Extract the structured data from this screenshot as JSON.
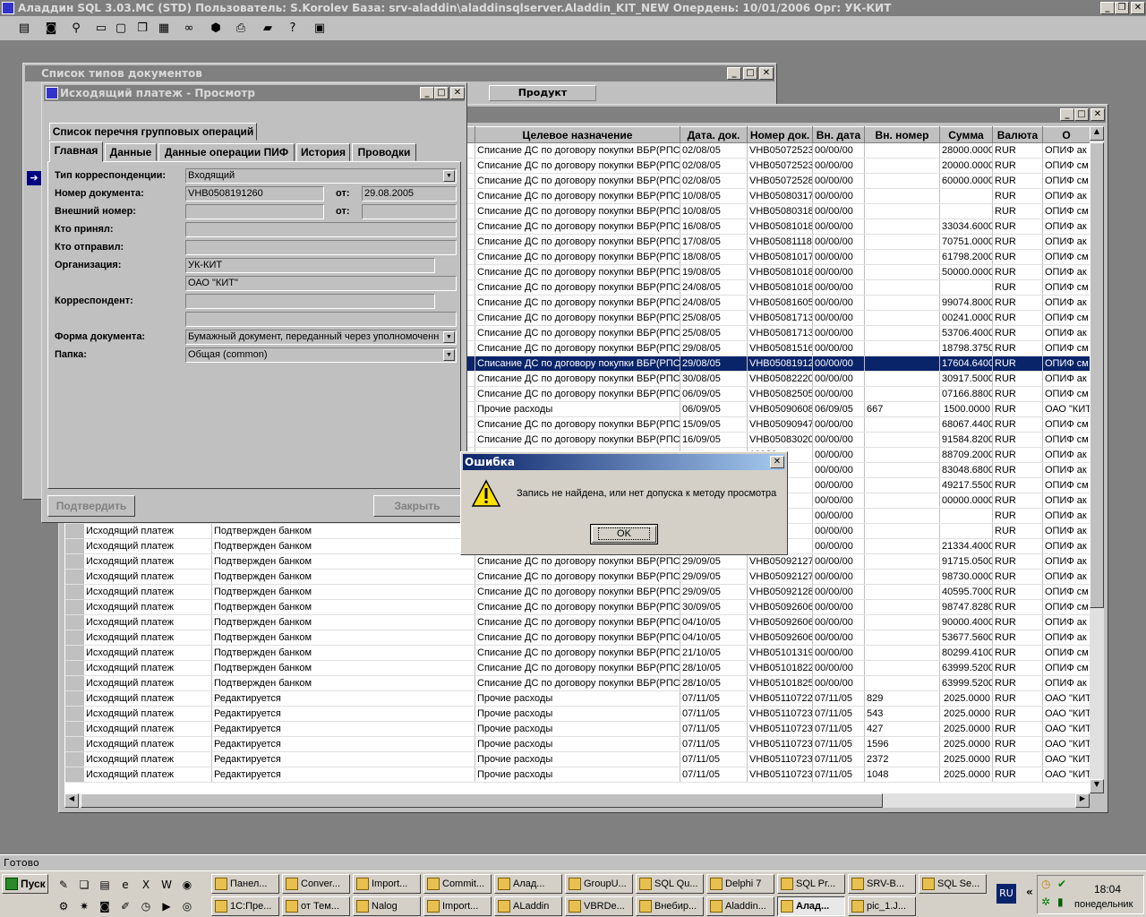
{
  "app": {
    "title": "Аладдин SQL 3.03.МС (STD)  Пользователь: S.Korolev База: srv-aladdin\\aladdinsqlserver.Aladdin_KIT_NEW Опердень: 10/01/2006 Орг: УК-КИТ"
  },
  "toolbar": {
    "icons": [
      "list-icon",
      "cylinder-icon",
      "find-person-icon",
      "window-icon",
      "windows-icon",
      "cascade-icon",
      "tile-icon",
      "binoculars-icon",
      "stop-icon",
      "printer-icon",
      "truck-icon",
      "help-icon",
      "exit-icon"
    ]
  },
  "doctypes_window": {
    "title": "Список типов документов",
    "col_product": "Продукт"
  },
  "list_window": {
    "columns": [
      "",
      "",
      "Целевое назначение",
      "Дата. док.",
      "Номер док.",
      "Вн. дата",
      "Вн. номер",
      "Сумма",
      "Валюта",
      "О"
    ],
    "rows": [
      [
        "",
        "",
        "Списание ДС по договору покупки ВБР(РПС",
        "02/08/05",
        "VHB050725230",
        "00/00/00",
        "",
        "28000.0000",
        "RUR",
        "ОПИФ ак"
      ],
      [
        "",
        "",
        "Списание ДС по договору покупки ВБР(РПС",
        "02/08/05",
        "VHB050725230",
        "00/00/00",
        "",
        "20000.0000",
        "RUR",
        "ОПИФ см"
      ],
      [
        "",
        "",
        "Списание ДС по договору покупки ВБР(РПС",
        "02/08/05",
        "VHB050725280",
        "00/00/00",
        "",
        "60000.0000",
        "RUR",
        "ОПИФ см"
      ],
      [
        "",
        "",
        "Списание ДС по договору покупки ВБР(РПС",
        "10/08/05",
        "VHB050803170",
        "00/00/00",
        "",
        "",
        "RUR",
        "ОПИФ ак"
      ],
      [
        "",
        "",
        "Списание ДС по договору покупки ВБР(РПС",
        "10/08/05",
        "VHB050803180",
        "00/00/00",
        "",
        "",
        "RUR",
        "ОПИФ см"
      ],
      [
        "",
        "",
        "Списание ДС по договору покупки ВБР(РПС",
        "16/08/05",
        "VHB050810180",
        "00/00/00",
        "",
        "33034.6000",
        "RUR",
        "ОПИФ ак"
      ],
      [
        "",
        "",
        "Списание ДС по договору покупки ВБР(РПС",
        "17/08/05",
        "VHB050811180",
        "00/00/00",
        "",
        "70751.0000",
        "RUR",
        "ОПИФ ак"
      ],
      [
        "",
        "",
        "Списание ДС по договору покупки ВБР(РПС",
        "18/08/05",
        "VHB050810170",
        "00/00/00",
        "",
        "61798.2000",
        "RUR",
        "ОПИФ см"
      ],
      [
        "",
        "",
        "Списание ДС по договору покупки ВБР(РПС",
        "19/08/05",
        "VHB050810180",
        "00/00/00",
        "",
        "50000.0000",
        "RUR",
        "ОПИФ ак"
      ],
      [
        "",
        "",
        "Списание ДС по договору покупки ВБР(РПС",
        "24/08/05",
        "VHB050810180",
        "00/00/00",
        "",
        "",
        "RUR",
        "ОПИФ см"
      ],
      [
        "",
        "",
        "Списание ДС по договору покупки ВБР(РПС",
        "24/08/05",
        "VHB050816050",
        "00/00/00",
        "",
        "99074.8000",
        "RUR",
        "ОПИФ ак"
      ],
      [
        "",
        "",
        "Списание ДС по договору покупки ВБР(РПС",
        "25/08/05",
        "VHB050817130",
        "00/00/00",
        "",
        "00241.0000",
        "RUR",
        "ОПИФ см"
      ],
      [
        "",
        "",
        "Списание ДС по договору покупки ВБР(РПС",
        "25/08/05",
        "VHB050817130",
        "00/00/00",
        "",
        "53706.4000",
        "RUR",
        "ОПИФ ак"
      ],
      [
        "",
        "",
        "Списание ДС по договору покупки ВБР(РПС",
        "29/08/05",
        "VHB050815160",
        "00/00/00",
        "",
        "18798.3750",
        "RUR",
        "ОПИФ см"
      ],
      [
        "",
        "",
        "Списание ДС по договору покупки ВБР(РПС",
        "29/08/05",
        "VHB050819120",
        "00/00/00",
        "",
        "17604.6400",
        "RUR",
        "ОПИФ см"
      ],
      [
        "",
        "",
        "Списание ДС по договору покупки ВБР(РПС",
        "30/08/05",
        "VHB050822200",
        "00/00/00",
        "",
        "30917.5000",
        "RUR",
        "ОПИФ ак"
      ],
      [
        "",
        "",
        "Списание ДС по договору покупки ВБР(РПС",
        "06/09/05",
        "VHB050825050",
        "00/00/00",
        "",
        "07166.8800",
        "RUR",
        "ОПИФ см"
      ],
      [
        "",
        "",
        "Прочие расходы",
        "06/09/05",
        "VHB050906080",
        "06/09/05",
        "667",
        "1500.0000",
        "RUR",
        "ОАО \"КИТ"
      ],
      [
        "",
        "",
        "Списание ДС по договору покупки ВБР(РПС",
        "15/09/05",
        "VHB050909470",
        "00/00/00",
        "",
        "68067.4400",
        "RUR",
        "ОПИФ см"
      ],
      [
        "",
        "",
        "Списание ДС по договору покупки ВБР(РПС",
        "16/09/05",
        "VHB050830200",
        "00/00/00",
        "",
        "91584.8200",
        "RUR",
        "ОПИФ см"
      ],
      [
        "",
        "",
        "",
        "",
        "10936",
        "00/00/00",
        "",
        "88709.2000",
        "RUR",
        "ОПИФ ак"
      ],
      [
        "",
        "",
        "",
        "",
        "11232",
        "00/00/00",
        "",
        "83048.6800",
        "RUR",
        "ОПИФ ак"
      ],
      [
        "",
        "",
        "",
        "",
        "11409",
        "00/00/00",
        "",
        "49217.5500",
        "RUR",
        "ОПИФ см"
      ],
      [
        "",
        "",
        "",
        "",
        "12124",
        "00/00/00",
        "",
        "00000.0000",
        "RUR",
        "ОПИФ ак"
      ],
      [
        "",
        "",
        "",
        "",
        "12126",
        "00/00/00",
        "",
        "",
        "RUR",
        "ОПИФ ак"
      ],
      [
        "Исходящий платеж",
        "Подтвержден банком",
        "",
        "",
        "12126",
        "00/00/00",
        "",
        "",
        "RUR",
        "ОПИФ ак"
      ],
      [
        "Исходящий платеж",
        "Подтвержден банком",
        "",
        "",
        "12128",
        "00/00/00",
        "",
        "21334.4000",
        "RUR",
        "ОПИФ ак"
      ],
      [
        "Исходящий платеж",
        "Подтвержден банком",
        "Списание ДС по договору покупки ВБР(РПС",
        "29/09/05",
        "VHB050921270",
        "00/00/00",
        "",
        "91715.0500",
        "RUR",
        "ОПИФ ак"
      ],
      [
        "Исходящий платеж",
        "Подтвержден банком",
        "Списание ДС по договору покупки ВБР(РПС",
        "29/09/05",
        "VHB050921270",
        "00/00/00",
        "",
        "98730.0000",
        "RUR",
        "ОПИФ ак"
      ],
      [
        "Исходящий платеж",
        "Подтвержден банком",
        "Списание ДС по договору покупки ВБР(РПС",
        "29/09/05",
        "VHB050921280",
        "00/00/00",
        "",
        "40595.7000",
        "RUR",
        "ОПИФ см"
      ],
      [
        "Исходящий платеж",
        "Подтвержден банком",
        "Списание ДС по договору покупки ВБР(РПС",
        "30/09/05",
        "VHB050926060",
        "00/00/00",
        "",
        "98747.8280",
        "RUR",
        "ОПИФ см"
      ],
      [
        "Исходящий платеж",
        "Подтвержден банком",
        "Списание ДС по договору покупки ВБР(РПС",
        "04/10/05",
        "VHB050926060",
        "00/00/00",
        "",
        "90000.4000",
        "RUR",
        "ОПИФ ак"
      ],
      [
        "Исходящий платеж",
        "Подтвержден банком",
        "Списание ДС по договору покупки ВБР(РПС",
        "04/10/05",
        "VHB050926060",
        "00/00/00",
        "",
        "53677.5600",
        "RUR",
        "ОПИФ ак"
      ],
      [
        "Исходящий платеж",
        "Подтвержден банком",
        "Списание ДС по договору покупки ВБР(РПС",
        "21/10/05",
        "VHB051013190",
        "00/00/00",
        "",
        "80299.4100",
        "RUR",
        "ОПИФ см"
      ],
      [
        "Исходящий платеж",
        "Подтвержден банком",
        "Списание ДС по договору покупки ВБР(РПС",
        "28/10/05",
        "VHB051018220",
        "00/00/00",
        "",
        "63999.5200",
        "RUR",
        "ОПИФ см"
      ],
      [
        "Исходящий платеж",
        "Подтвержден банком",
        "Списание ДС по договору покупки ВБР(РПС",
        "28/10/05",
        "VHB051018250",
        "00/00/00",
        "",
        "63999.5200",
        "RUR",
        "ОПИФ ак"
      ],
      [
        "Исходящий платеж",
        "Редактируется",
        "Прочие расходы",
        "07/11/05",
        "VHB051107220",
        "07/11/05",
        "829",
        "2025.0000",
        "RUR",
        "ОАО \"КИТ"
      ],
      [
        "Исходящий платеж",
        "Редактируется",
        "Прочие расходы",
        "07/11/05",
        "VHB051107230",
        "07/11/05",
        "543",
        "2025.0000",
        "RUR",
        "ОАО \"КИТ"
      ],
      [
        "Исходящий платеж",
        "Редактируется",
        "Прочие расходы",
        "07/11/05",
        "VHB051107230",
        "07/11/05",
        "427",
        "2025.0000",
        "RUR",
        "ОАО \"КИТ"
      ],
      [
        "Исходящий платеж",
        "Редактируется",
        "Прочие расходы",
        "07/11/05",
        "VHB051107230",
        "07/11/05",
        "1596",
        "2025.0000",
        "RUR",
        "ОАО \"КИТ"
      ],
      [
        "Исходящий платеж",
        "Редактируется",
        "Прочие расходы",
        "07/11/05",
        "VHB051107230",
        "07/11/05",
        "2372",
        "2025.0000",
        "RUR",
        "ОАО \"КИТ"
      ],
      [
        "Исходящий платеж",
        "Редактируется",
        "Прочие расходы",
        "07/11/05",
        "VHB051107230",
        "07/11/05",
        "1048",
        "2025.0000",
        "RUR",
        "ОАО \"КИТ"
      ]
    ],
    "selected_row": 14
  },
  "form": {
    "title": "Исходящий платеж - Просмотр",
    "tab_top": "Список перечня групповых операций",
    "tabs": [
      "Главная",
      "Данные",
      "Данные операции ПИФ",
      "История",
      "Проводки"
    ],
    "labels": {
      "corr_type": "Тип корреспонденции:",
      "doc_number": "Номер документа:",
      "ext_number": "Внешний номер:",
      "received_by": "Кто принял:",
      "sent_by": "Кто отправил:",
      "organization": "Организация:",
      "correspondent": "Корреспондент:",
      "doc_form": "Форма документа:",
      "folder": "Папка:",
      "from1": "от:",
      "from2": "от:"
    },
    "values": {
      "corr_type": "Входящий",
      "doc_number": "VHB0508191260",
      "doc_date": "29.08.2005",
      "org1": "УК-КИТ",
      "org2": "ОАО \"КИТ\"",
      "doc_form": "Бумажный документ, переданный через уполномоченн",
      "folder": "Общая (common)"
    },
    "confirm": "Подтвердить",
    "close": "Закрыть"
  },
  "dialog": {
    "title": "Ошибка",
    "message": "Запись не найдена, или нет допуска к методу просмотра",
    "ok": "OK"
  },
  "status": "Готово",
  "taskbar": {
    "start": "Пуск",
    "row1": [
      "Панел...",
      "Conver...",
      "Import...",
      "Commit...",
      "Алад...",
      "GroupU...",
      "SQL Qu...",
      "Delphi 7",
      "SQL Pr...",
      "SRV-B...",
      "SQL Se..."
    ],
    "row2": [
      "1С:Пре...",
      "от Тем...",
      "Nalog",
      "Import...",
      "ALaddin",
      "VBRDe...",
      "Внебир...",
      "Aladdin...",
      "Алад...",
      "pic_1.J..."
    ],
    "lang": "RU",
    "time": "18:04",
    "day": "понедельник"
  }
}
